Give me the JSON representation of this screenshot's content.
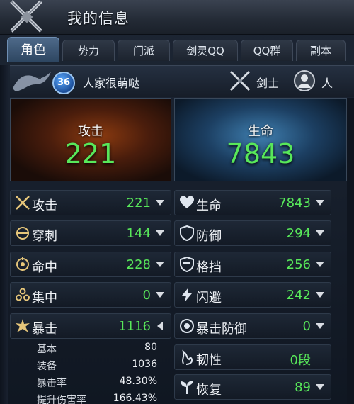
{
  "window": {
    "title": "我的信息"
  },
  "tabs": [
    {
      "label": "角色",
      "active": true
    },
    {
      "label": "势力",
      "active": false
    },
    {
      "label": "门派",
      "active": false
    },
    {
      "label": "剑灵QQ",
      "active": false
    },
    {
      "label": "QQ群",
      "active": false
    },
    {
      "label": "副本",
      "active": false
    }
  ],
  "character": {
    "level": "36",
    "name": "人家很萌哒",
    "class": "剑士",
    "race": "人"
  },
  "summary": {
    "attack": {
      "label": "攻击",
      "value": "221"
    },
    "health": {
      "label": "生命",
      "value": "7843"
    }
  },
  "left_stats": [
    {
      "label": "攻击",
      "value": "221",
      "icon": "crossed-swords-icon"
    },
    {
      "label": "穿刺",
      "value": "144",
      "icon": "pierce-icon"
    },
    {
      "label": "命中",
      "value": "228",
      "icon": "target-icon"
    },
    {
      "label": "集中",
      "value": "0",
      "icon": "focus-icon"
    },
    {
      "label": "暴击",
      "value": "1116",
      "icon": "critical-burst-icon"
    }
  ],
  "crit_details": [
    {
      "label": "基本",
      "value": "80"
    },
    {
      "label": "装备",
      "value": "1036"
    },
    {
      "label": "暴击率",
      "value": "48.30%"
    },
    {
      "label": "提升伤害率",
      "value": "166.43%"
    }
  ],
  "right_stats": [
    {
      "label": "生命",
      "value": "7843",
      "icon": "heart-icon"
    },
    {
      "label": "防御",
      "value": "294",
      "icon": "shield-icon"
    },
    {
      "label": "格挡",
      "value": "256",
      "icon": "block-shield-icon"
    },
    {
      "label": "闪避",
      "value": "242",
      "icon": "evade-bolt-icon"
    },
    {
      "label": "暴击防御",
      "value": "0",
      "icon": "crit-defense-icon"
    },
    {
      "label": "韧性",
      "value": "0段",
      "icon": "toughness-icon"
    },
    {
      "label": "恢复",
      "value": "89",
      "icon": "recovery-sprout-icon"
    }
  ],
  "colors": {
    "value_green": "#58e85a",
    "text_white": "#f0f3f7",
    "accent_tab": "#4e6a8a"
  }
}
